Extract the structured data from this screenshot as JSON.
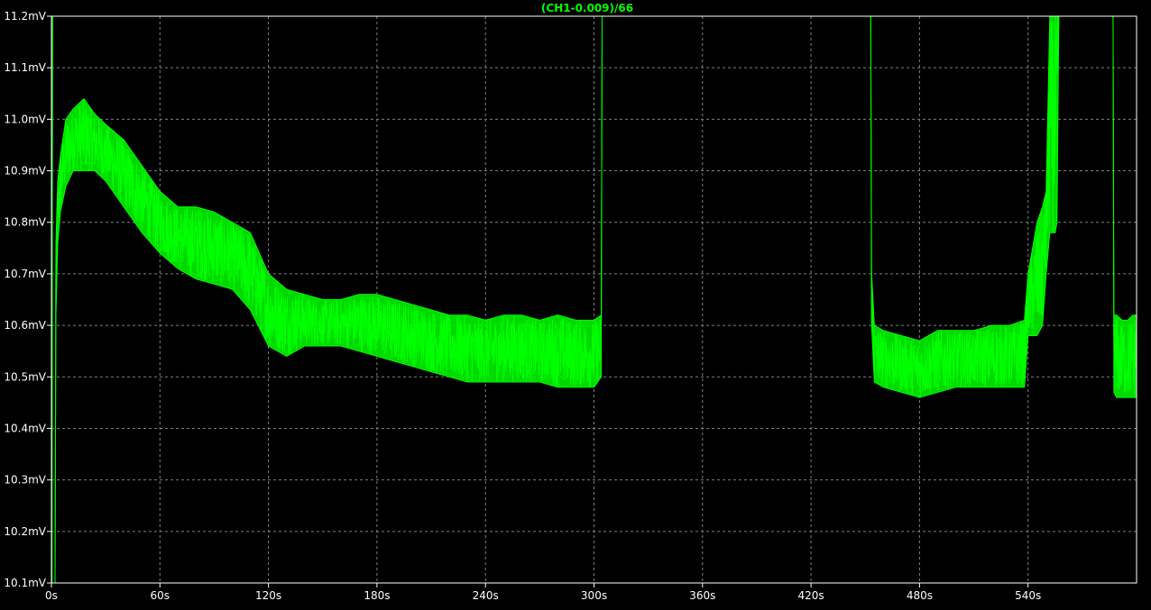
{
  "chart_data": {
    "type": "line",
    "title": "(CH1-0.009)/66",
    "xlabel": "",
    "ylabel": "",
    "x_unit": "s",
    "y_unit": "mV",
    "xlim": [
      0,
      600
    ],
    "ylim": [
      10.1,
      11.2
    ],
    "x_ticks": [
      0,
      60,
      120,
      180,
      240,
      300,
      360,
      420,
      480,
      540
    ],
    "x_tick_labels": [
      "0s",
      "60s",
      "120s",
      "180s",
      "240s",
      "300s",
      "360s",
      "420s",
      "480s",
      "540s"
    ],
    "y_ticks": [
      10.1,
      10.2,
      10.3,
      10.4,
      10.5,
      10.6,
      10.7,
      10.8,
      10.9,
      11.0,
      11.1,
      11.2
    ],
    "y_tick_labels": [
      "10.1mV",
      "10.2mV",
      "10.3mV",
      "10.4mV",
      "10.5mV",
      "10.6mV",
      "10.7mV",
      "10.8mV",
      "10.9mV",
      "11.0mV",
      "11.1mV",
      "11.2mV"
    ],
    "grid": true,
    "legend": "none",
    "colors": {
      "background": "#000000",
      "trace": "#00ff00",
      "grid": "#808080",
      "axis_text": "#ffffff",
      "title": "#00ff00"
    },
    "series": [
      {
        "name": "(CH1-0.009)/66",
        "segments": [
          {
            "x": [
              2.0,
              2.5,
              3.5,
              5,
              8,
              12,
              18,
              24,
              30,
              40,
              50,
              60,
              70,
              80,
              90,
              100,
              110,
              120,
              130,
              140,
              150,
              160,
              170,
              180,
              190,
              200,
              210,
              220,
              230,
              240,
              250,
              260,
              270,
              280,
              290,
              300,
              304,
              304.5
            ],
            "y": [
              10.1,
              10.7,
              10.82,
              10.87,
              10.93,
              10.96,
              10.97,
              10.96,
              10.94,
              10.89,
              10.84,
              10.8,
              10.77,
              10.75,
              10.76,
              10.74,
              10.7,
              10.62,
              10.6,
              10.61,
              10.6,
              10.6,
              10.59,
              10.6,
              10.59,
              10.59,
              10.57,
              10.56,
              10.55,
              10.55,
              10.56,
              10.55,
              10.55,
              10.55,
              10.55,
              10.55,
              10.56,
              11.2
            ],
            "upper": [
              10.1,
              10.76,
              10.88,
              10.93,
              11.0,
              11.02,
              11.04,
              11.01,
              10.99,
              10.96,
              10.91,
              10.86,
              10.83,
              10.83,
              10.82,
              10.8,
              10.78,
              10.7,
              10.67,
              10.66,
              10.65,
              10.65,
              10.66,
              10.66,
              10.65,
              10.64,
              10.63,
              10.62,
              10.62,
              10.61,
              10.62,
              10.62,
              10.61,
              10.62,
              10.61,
              10.61,
              10.62,
              11.2
            ],
            "lower": [
              10.1,
              10.62,
              10.76,
              10.82,
              10.87,
              10.9,
              10.9,
              10.9,
              10.88,
              10.83,
              10.78,
              10.74,
              10.71,
              10.69,
              10.68,
              10.67,
              10.63,
              10.56,
              10.54,
              10.56,
              10.56,
              10.56,
              10.55,
              10.54,
              10.53,
              10.52,
              10.51,
              10.5,
              10.49,
              10.49,
              10.49,
              10.49,
              10.49,
              10.48,
              10.48,
              10.48,
              10.5,
              11.2
            ]
          },
          {
            "x": [
              0.3,
              0.6
            ],
            "y": [
              10.1,
              11.2
            ],
            "upper": [
              10.1,
              11.2
            ],
            "lower": [
              10.1,
              11.2
            ]
          },
          {
            "x": [
              453,
              453.5,
              455,
              460,
              470,
              480,
              490,
              500,
              510,
              520,
              530,
              538,
              540,
              545,
              548,
              550,
              552,
              555,
              556,
              557
            ],
            "y": [
              11.2,
              10.65,
              10.55,
              10.52,
              10.52,
              10.51,
              10.53,
              10.54,
              10.54,
              10.54,
              10.54,
              10.55,
              10.6,
              10.62,
              10.75,
              10.79,
              10.8,
              10.85,
              11.0,
              11.2
            ],
            "upper": [
              11.2,
              10.7,
              10.6,
              10.59,
              10.58,
              10.57,
              10.59,
              10.59,
              10.59,
              10.6,
              10.6,
              10.61,
              10.7,
              10.8,
              10.83,
              10.86,
              11.2,
              11.2,
              11.2,
              11.2
            ],
            "lower": [
              11.2,
              10.6,
              10.49,
              10.48,
              10.47,
              10.46,
              10.47,
              10.48,
              10.48,
              10.48,
              10.48,
              10.48,
              10.58,
              10.58,
              10.6,
              10.7,
              10.78,
              10.78,
              10.8,
              11.2
            ]
          },
          {
            "x": [
              587,
              587.5,
              589,
              592,
              595,
              598,
              600
            ],
            "y": [
              11.2,
              10.55,
              10.53,
              10.53,
              10.53,
              10.53,
              10.53
            ],
            "upper": [
              11.2,
              10.62,
              10.62,
              10.61,
              10.61,
              10.62,
              10.62
            ],
            "lower": [
              11.2,
              10.47,
              10.46,
              10.46,
              10.46,
              10.46,
              10.46
            ]
          }
        ]
      }
    ]
  }
}
